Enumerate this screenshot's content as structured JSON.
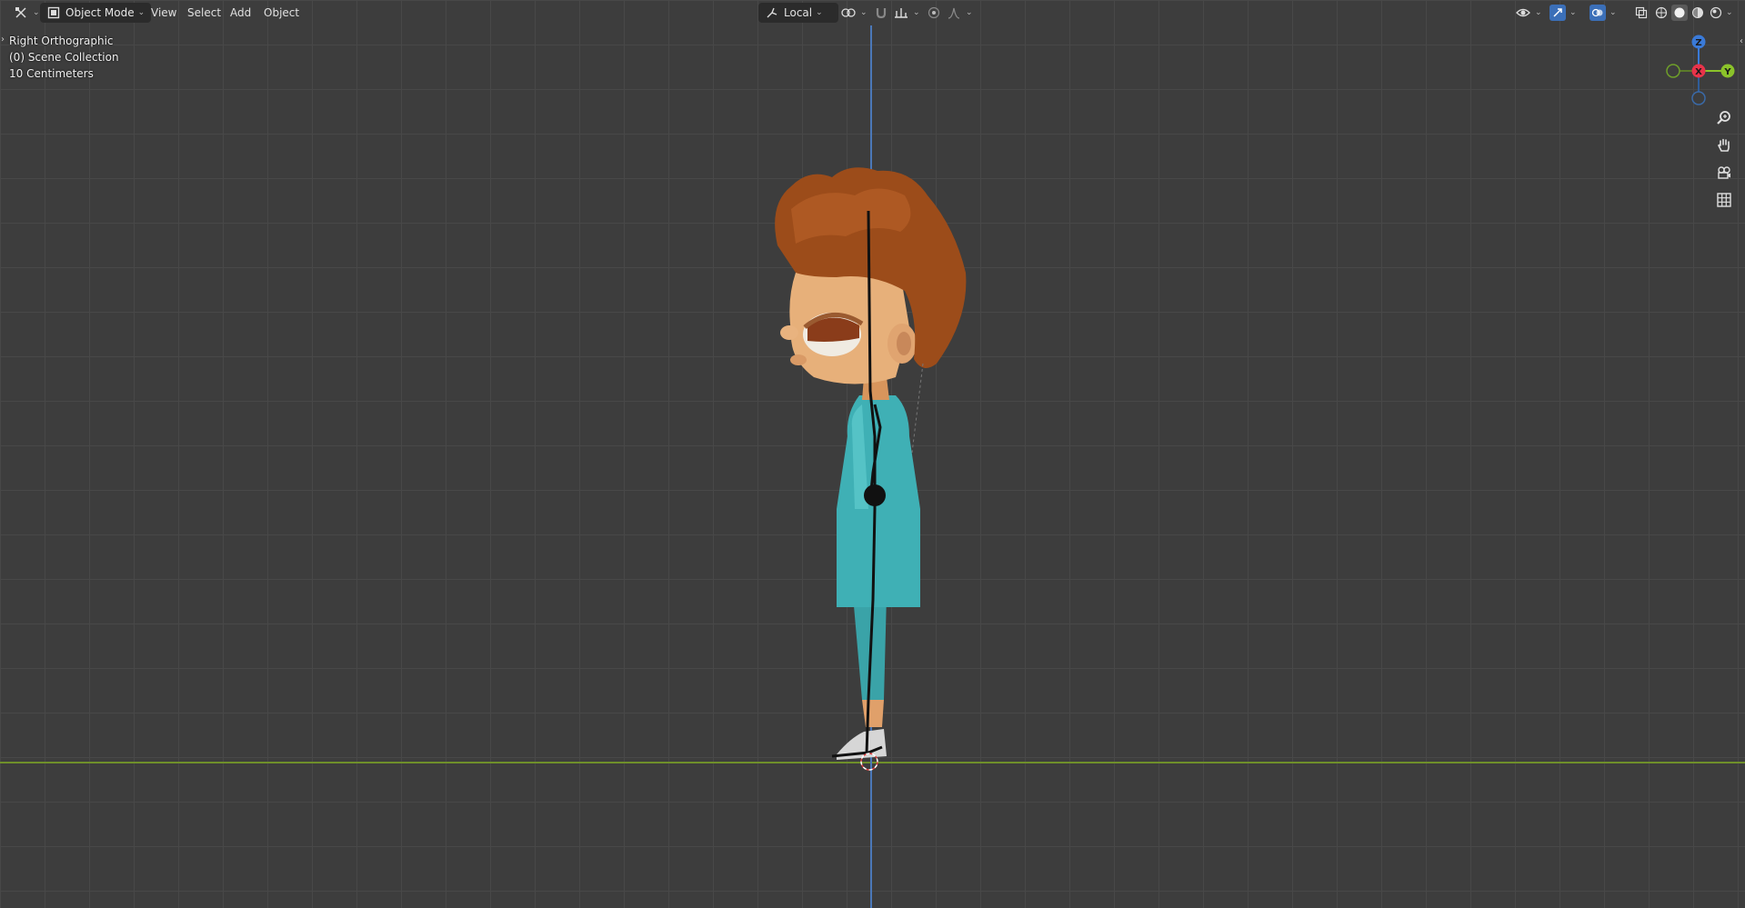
{
  "header": {
    "mode_label": "Object Mode",
    "menus": [
      "View",
      "Select",
      "Add",
      "Object"
    ],
    "transform_orientation": "Local"
  },
  "overlay": {
    "view_name": "Right Orthographic",
    "collection": "(0) Scene Collection",
    "scale": "10 Centimeters"
  },
  "gizmo": {
    "z_label": "Z",
    "x_label": "X",
    "y_label": "Y",
    "colors": {
      "x": "#e8334a",
      "y": "#8bc32a",
      "z": "#3a7ad8"
    }
  },
  "icons": {
    "editor_type": "transform-tool-icon",
    "mode": "object-mode-icon",
    "pivot": "pivot-icon",
    "snap": "magnet-icon",
    "increment": "increment-icon",
    "proportional": "proportional-edit-icon",
    "falloff": "falloff-icon",
    "visibility": "eye-icon",
    "gizmos": "gizmo-icon",
    "overlays": "overlay-icon",
    "xray": "xray-icon",
    "shading": [
      "wireframe-icon",
      "solid-icon",
      "material-icon",
      "rendered-icon"
    ],
    "nav": [
      "zoom-icon",
      "hand-pan-icon",
      "camera-icon",
      "grid-ortho-icon"
    ]
  }
}
